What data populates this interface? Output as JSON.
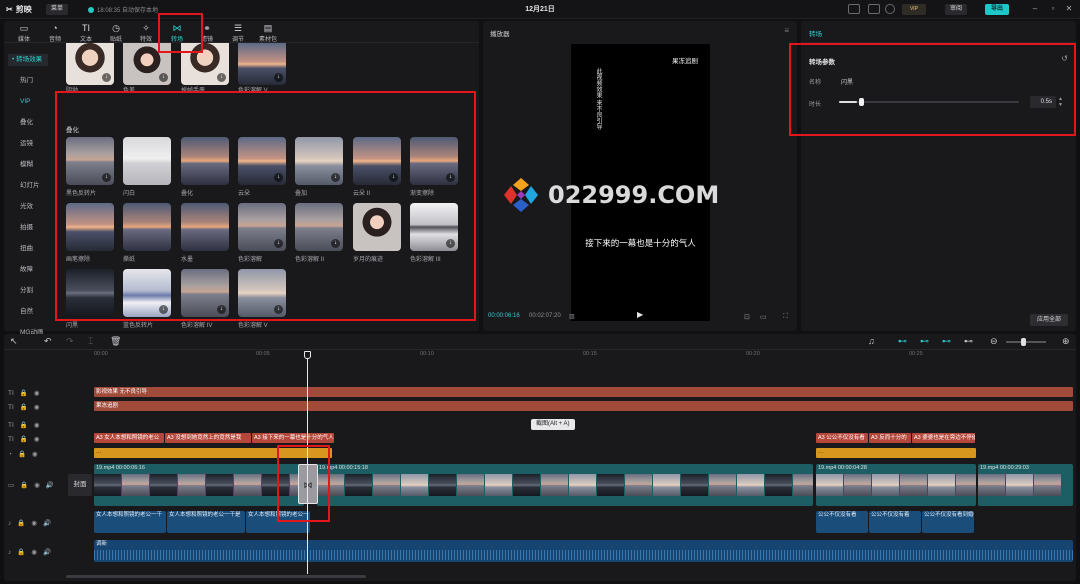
{
  "titlebar": {
    "app_name": "剪映",
    "menu_label": "菜单",
    "save_status": "18:08:35 自动保存本地",
    "project_title": "12月21日",
    "review_label": "审阅",
    "export_label": "导出",
    "vip_label": "VIP"
  },
  "top_tabs": [
    {
      "label": "媒体",
      "icon": "media-icon"
    },
    {
      "label": "音频",
      "icon": "audio-icon"
    },
    {
      "label": "文本",
      "icon": "text-icon"
    },
    {
      "label": "贴纸",
      "icon": "sticker-icon"
    },
    {
      "label": "特效",
      "icon": "effects-icon"
    },
    {
      "label": "转场",
      "icon": "transition-icon"
    },
    {
      "label": "滤镜",
      "icon": "filter-icon"
    },
    {
      "label": "调节",
      "icon": "adjust-icon"
    },
    {
      "label": "素材包",
      "icon": "package-icon"
    }
  ],
  "side_nav": {
    "items": [
      {
        "label": "• 转场效果",
        "active": true
      },
      {
        "label": "热门"
      },
      {
        "label": "VIP"
      },
      {
        "label": "叠化"
      },
      {
        "label": "运镜"
      },
      {
        "label": "模糊"
      },
      {
        "label": "幻灯片"
      },
      {
        "label": "光效"
      },
      {
        "label": "拍摄"
      },
      {
        "label": "扭曲"
      },
      {
        "label": "故障"
      },
      {
        "label": "分割"
      },
      {
        "label": "自然"
      },
      {
        "label": "MG动画"
      }
    ]
  },
  "library": {
    "top_row": [
      {
        "name": "阴坳"
      },
      {
        "name": "色差"
      },
      {
        "name": "掉帧手册"
      },
      {
        "name": "色彩溶解 V"
      }
    ],
    "category_title": "叠化",
    "grid": [
      {
        "name": "黑色反转片"
      },
      {
        "name": "闪白"
      },
      {
        "name": "叠化"
      },
      {
        "name": "云朵"
      },
      {
        "name": "叠加"
      },
      {
        "name": "云朵 II"
      },
      {
        "name": "渐变擦除"
      },
      {
        "name": "画笔擦除"
      },
      {
        "name": "撕纸"
      },
      {
        "name": "水墨"
      },
      {
        "name": "色彩溶解"
      },
      {
        "name": "色彩溶解 II"
      },
      {
        "name": "岁月的痕迹"
      },
      {
        "name": "色彩溶解 III"
      },
      {
        "name": "闪黑"
      },
      {
        "name": "蓝色反转片"
      },
      {
        "name": "色彩溶解 IV"
      },
      {
        "name": "色彩溶解 V"
      }
    ],
    "footer_label": "运镜"
  },
  "player": {
    "title": "播放器",
    "frame_top_text": "果冻追剧",
    "frame_vertical_text": "此视频效果 来不良引导",
    "caption": "接下来的一幕也是十分的气人",
    "watermark": "022999.COM",
    "current_time": "00:00:06:16",
    "total_time": "00:02:07:20"
  },
  "detail": {
    "tab_label": "转场",
    "section_title": "转场参数",
    "name_label": "名称",
    "name_value": "闪黑",
    "duration_label": "时长",
    "duration_value": "0.5s",
    "duration_fraction": 0.05,
    "apply_all_label": "应用全部"
  },
  "timeline": {
    "ruler_ticks": [
      "00:00",
      "00:05",
      "00:10",
      "00:15",
      "00:20",
      "00:25"
    ],
    "tooltip": "截图(Alt + A)",
    "cover_label": "封面",
    "text_tracks": [
      {
        "label": "影视效果 无不良引导"
      },
      {
        "label": "果冻追剧"
      }
    ],
    "subtitle_clips_left": [
      "A3 女人本想和照镜的老公",
      "A3 没想到她竟然上的竟然是我",
      "A3 接下来的一幕也是十分的气人"
    ],
    "subtitle_clips_right": [
      "A3 公公不仅没有看",
      "A3 反而十分的",
      "A3 婆婆也是在旁边不停催"
    ],
    "video_clips": [
      {
        "label": "19.mp4  00:00:06:16"
      },
      {
        "label": "19.mp4  00:00:15:18"
      },
      {
        "label": "19.mp4  00:00:04:28"
      },
      {
        "label": "19.mp4  00:00:29:03"
      }
    ],
    "vo_clips_left": [
      "女人本想和照镜的老公一干",
      "女人本想和照镜的老公一干是",
      "女人本想和照镜的老公一"
    ],
    "vo_clips_right": [
      "公公不仅没有看",
      "公公不仅没有着",
      "公公不仅没有看到婚礼"
    ],
    "music_label": "调新"
  }
}
